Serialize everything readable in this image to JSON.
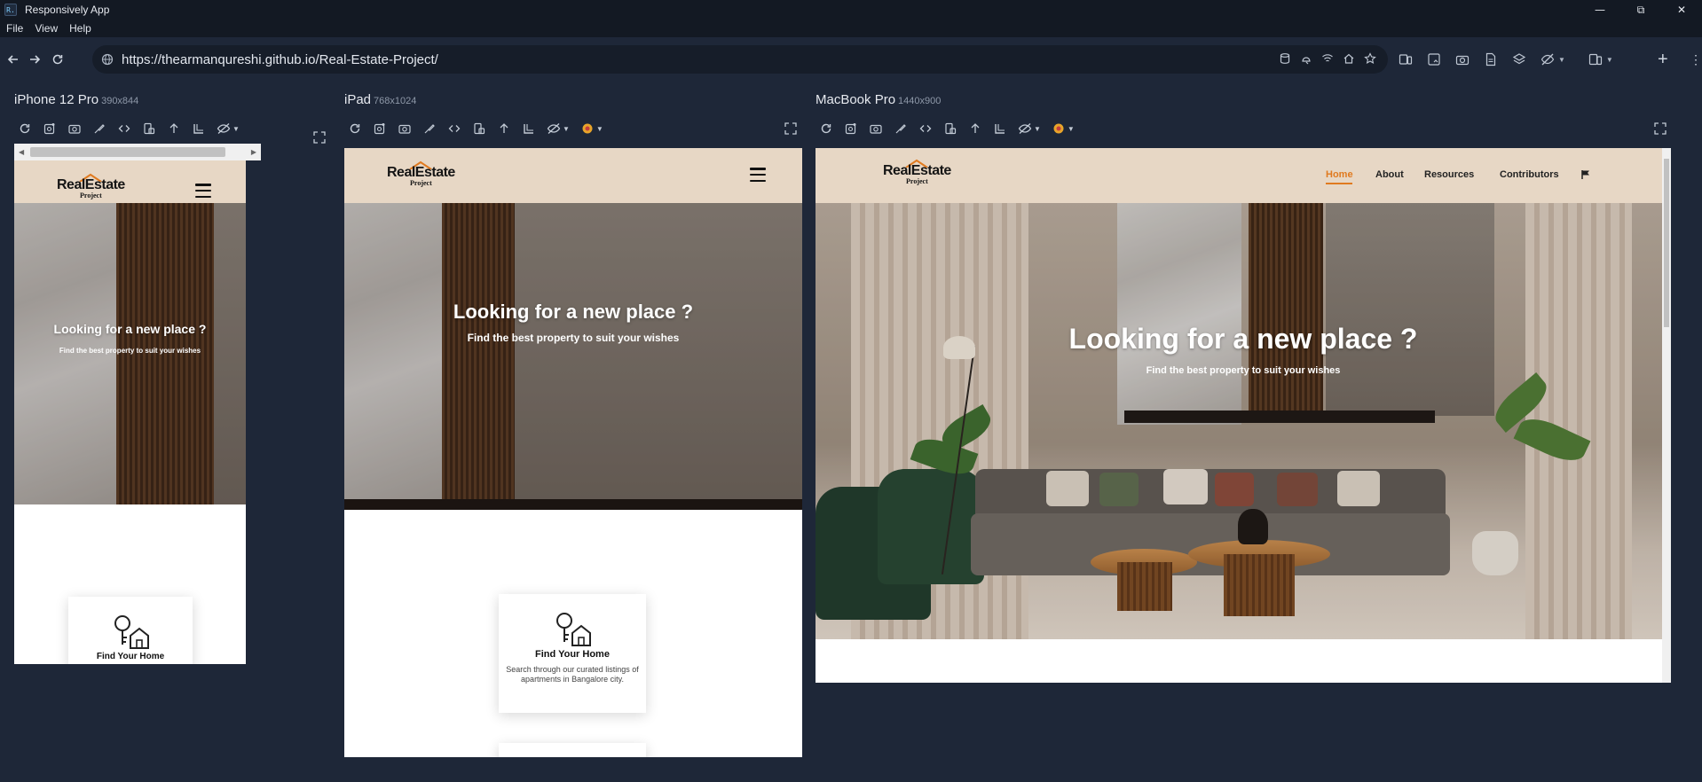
{
  "window": {
    "title": "Responsively App",
    "controls": [
      "minimize-icon",
      "restore-icon",
      "close-icon"
    ]
  },
  "menu": [
    "File",
    "View",
    "Help"
  ],
  "address_bar": {
    "url": "https://thearmanqureshi.github.io/Real-Estate-Project/"
  },
  "toolbar_icons": [
    "back-icon",
    "forward-icon",
    "reload-icon",
    "globe-icon"
  ],
  "devices": [
    {
      "name": "iPhone 12 Pro",
      "dims": "390x844"
    },
    {
      "name": "iPad",
      "dims": "768x1024"
    },
    {
      "name": "MacBook Pro",
      "dims": "1440x900"
    }
  ],
  "site": {
    "logo_main": "RealEstate",
    "logo_sub": "Project",
    "hero_title": "Looking for a new place ?",
    "hero_sub": "Find the best property to suit your wishes",
    "nav": [
      "Home",
      "About",
      "Resources",
      "Contributors"
    ],
    "card_title": "Find Your Home",
    "card_desc": "Search through our curated listings of apartments in Bangalore city."
  },
  "colors": {
    "background": "#1e2738",
    "titlebar": "#131923",
    "header_beige": "#e7d7c5",
    "accent_orange": "#e07a1f"
  }
}
